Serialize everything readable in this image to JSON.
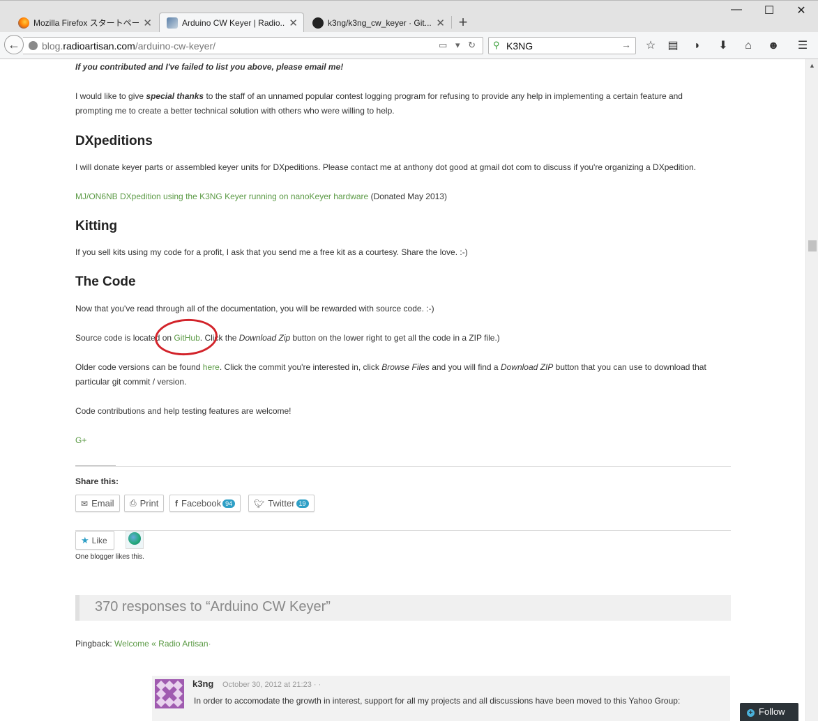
{
  "browser": {
    "tabs": [
      {
        "title": "Mozilla Firefox スタートページ",
        "active": false
      },
      {
        "title": "Arduino CW Keyer | Radio...",
        "active": true
      },
      {
        "title": "k3ng/k3ng_cw_keyer · Git...",
        "active": false
      }
    ],
    "new_tab": "+",
    "window_controls": {
      "minimize": "—",
      "maximize": "☐",
      "close": "✕"
    },
    "url_prefix": "blog.",
    "url_domain": "radioartisan.com",
    "url_path": "/arduino-cw-keyer/",
    "search_value": "K3NG",
    "toolbar_icons": [
      "bookmark-star-icon",
      "reading-list-icon",
      "pocket-icon",
      "download-icon",
      "home-icon",
      "hello-icon",
      "menu-icon"
    ]
  },
  "article": {
    "contrib_note": "If you contributed and I've failed to list you above, please email me!",
    "thanks_pre": "I would like to give ",
    "thanks_em": "special thanks",
    "thanks_post": " to the staff of an unnamed popular contest logging program for refusing to provide any help in implementing a certain feature and",
    "thanks_line2": "prompting me to create a better technical solution with others who were willing to help.",
    "dxped_heading": "DXpeditions",
    "dxped_text": "I will donate keyer parts or assembled keyer units for DXpeditions.  Please contact me at anthony dot good at gmail dot com to discuss if you're organizing a DXpedition.",
    "dxped_link": "MJ/ON6NB DXpedition using the K3NG Keyer running on nanoKeyer hardware",
    "dxped_link_suffix": " (Donated May 2013)",
    "kitting_heading": "Kitting",
    "kitting_text": "If you sell kits using my code for a profit, I ask that you send me a free kit as a courtesy.  Share the love. :-)",
    "code_heading": "The Code",
    "code_intro": "Now that you've read through all of the documentation, you will be rewarded with source code.  :-)",
    "source_pre": "Source code is located on ",
    "source_link": "GitHub",
    "source_mid": ".  Click the ",
    "source_em": "Download Zip",
    "source_post": " button on the lower right to get all the code in a ZIP file.)",
    "older_pre": "Older code versions can be found ",
    "older_link": "here",
    "older_mid": ".  Click the commit you're interested in, click ",
    "older_em1": "Browse Files",
    "older_mid2": " and you will find a ",
    "older_em2": "Download ZIP",
    "older_post": " button that you can use to download that",
    "older_line2": "particular git commit / version.",
    "contrib_welcome": "Code contributions and help testing features are welcome!",
    "gplus": "G+"
  },
  "share": {
    "heading": "Share this:",
    "buttons": [
      {
        "label": "Email",
        "icon": "email-icon"
      },
      {
        "label": "Print",
        "icon": "print-icon"
      },
      {
        "label": "Facebook",
        "icon": "facebook-icon",
        "count": "94"
      },
      {
        "label": "Twitter",
        "icon": "twitter-icon",
        "count": "19"
      }
    ]
  },
  "like": {
    "label": "Like",
    "caption": "One blogger likes this."
  },
  "responses": {
    "title": "370 responses to “Arduino CW Keyer”",
    "pingback_label": "Pingback: ",
    "pingback_link": "Welcome « Radio Artisan",
    "pingback_suffix": "·"
  },
  "comment": {
    "author": "k3ng",
    "date": "October 30, 2012 at 21:23",
    "date_suffix": " · ·",
    "text": "In order to accomodate the growth in interest, support for all my projects and all discussions have been moved to this Yahoo Group:"
  },
  "follow": {
    "label": "Follow",
    "icon": "plus-icon"
  },
  "colors": {
    "link": "#5b9a45",
    "annotation_circle": "#d2232a",
    "count_badge": "#2e9fc6",
    "follow_bg": "#2c3338"
  }
}
